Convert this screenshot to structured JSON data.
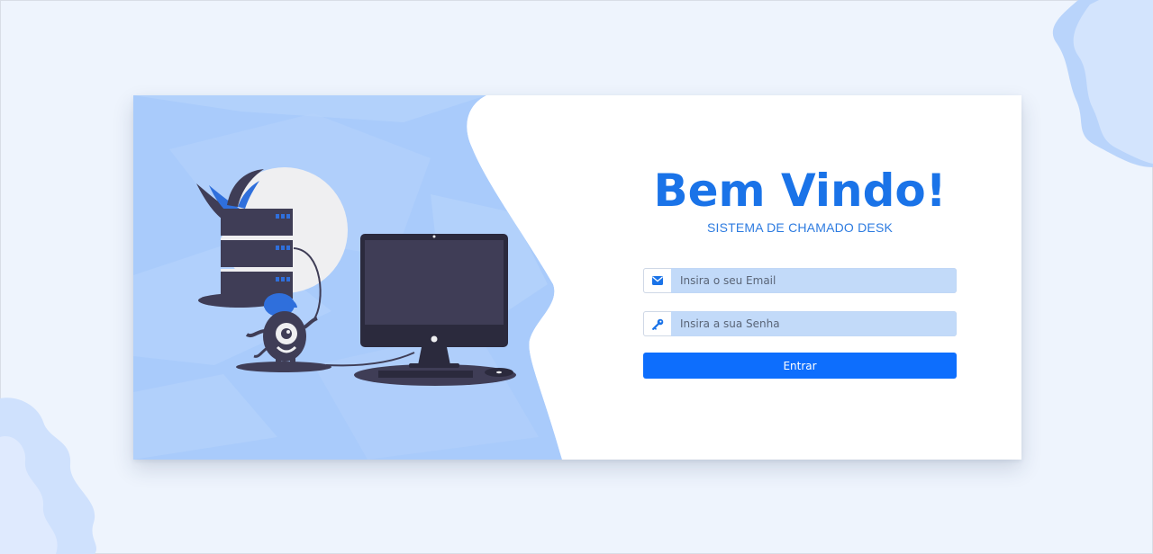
{
  "welcome": {
    "title": "Bem Vindo!",
    "subtitle": "SISTEMA DE CHAMADO DESK"
  },
  "login_form": {
    "email": {
      "value": "",
      "placeholder": "Insira o seu Email",
      "icon": "envelope-icon"
    },
    "password": {
      "value": "",
      "placeholder": "Insira a sua Senha",
      "icon": "key-icon"
    },
    "submit_label": "Entrar"
  },
  "colors": {
    "accent": "#0d6efd",
    "title": "#1a73e8",
    "input_background": "#c2daf9",
    "illustration_background": "#a9cbfb",
    "page_background": "#eef4fd"
  }
}
